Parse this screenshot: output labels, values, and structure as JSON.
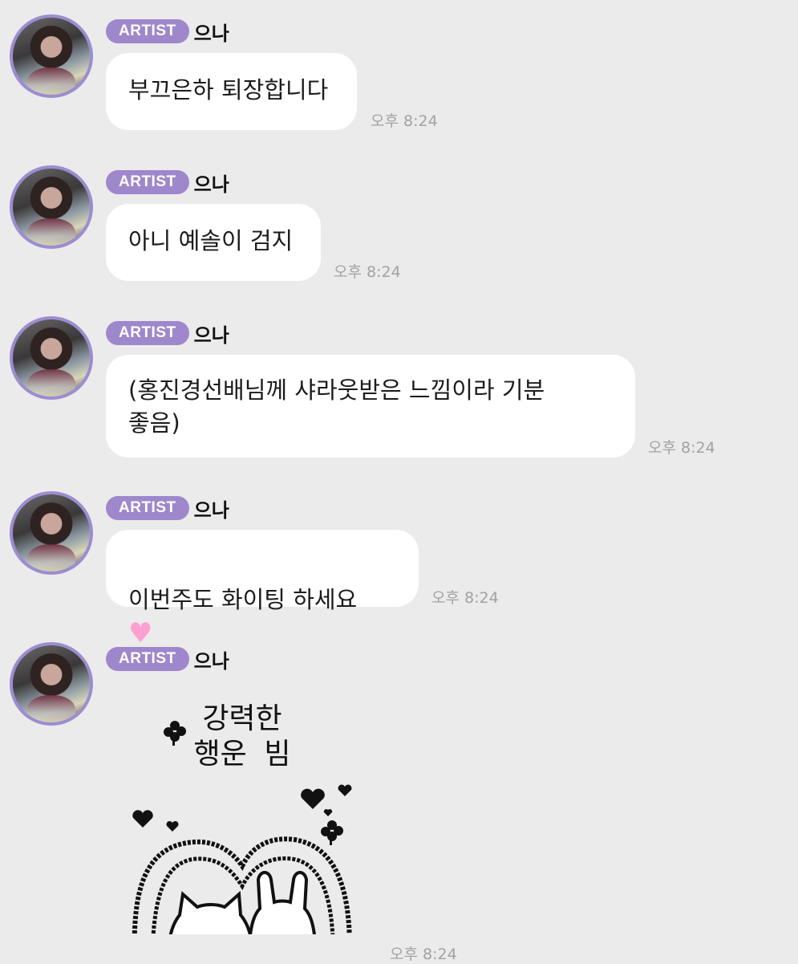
{
  "messages": [
    {
      "badge": "ARTIST",
      "sender": "으나",
      "text": "부끄은하 퇴장합니다",
      "time": "오후 8:24"
    },
    {
      "badge": "ARTIST",
      "sender": "으나",
      "text": "아니 예솔이 검지",
      "time": "오후 8:24"
    },
    {
      "badge": "ARTIST",
      "sender": "으나",
      "text": "(홍진경선배님께 샤라웃받은 느낌이라 기분\n좋음)",
      "time": "오후 8:24"
    },
    {
      "badge": "ARTIST",
      "sender": "으나",
      "text": "이번주도 화이팅 하세요",
      "emoji": "♥",
      "time": "오후 8:24"
    },
    {
      "badge": "ARTIST",
      "sender": "으나",
      "sticker_text": "강력한\n행운 빔",
      "time": "오후 8:24"
    }
  ],
  "colors": {
    "background": "#ebebeb",
    "bubble": "#ffffff",
    "badge": "#9f87cc",
    "avatar_ring": "#9c8cd0",
    "timestamp": "#a2a2a2"
  }
}
